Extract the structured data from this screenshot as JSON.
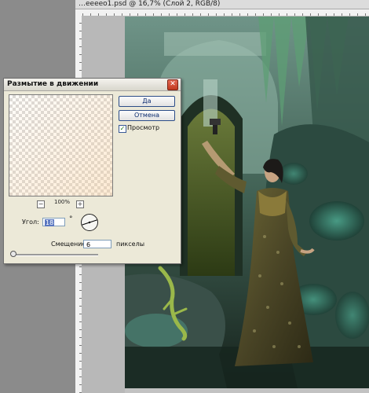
{
  "document": {
    "title": "…eeeeo1.psd @ 16,7% (Слой 2, RGB/8)"
  },
  "dialog": {
    "title": "Размытие в движении",
    "close_glyph": "✕",
    "ok_label": "Да",
    "cancel_label": "Отмена",
    "preview_label": "Просмотр",
    "preview_checked": true,
    "zoom_minus": "−",
    "zoom_plus": "+",
    "zoom_level": "100%",
    "angle_label": "Угол:",
    "angle_value": "18",
    "degree_sign": "°",
    "offset_label": "Смещение:",
    "offset_value": "6",
    "offset_unit": "пикселы",
    "offset_slider_fraction": 0.01
  },
  "icons": {
    "close": "close-icon",
    "check": "checkmark-icon",
    "dial": "angle-dial-icon"
  },
  "colors": {
    "dialog_bg": "#ece9d8",
    "button_border": "#2c4d88",
    "workspace": "#8b8b8b"
  }
}
